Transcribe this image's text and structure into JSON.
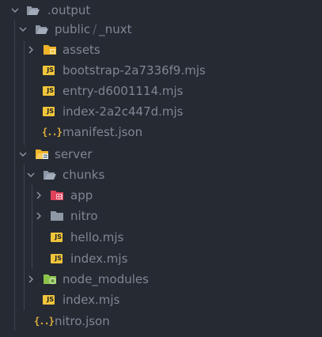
{
  "explorer": {
    "root": {
      "label": ".output",
      "icon": "folder-open-icon"
    },
    "public": {
      "label": "public",
      "separator": "/",
      "label_suffix": "_nuxt",
      "icon": "folder-open-icon"
    },
    "assets": {
      "label": "assets",
      "icon": "folder-assets-icon"
    },
    "bootstrap": {
      "label": "bootstrap-2a7336f9.mjs",
      "icon_text": "JS"
    },
    "entry": {
      "label": "entry-d6001114.mjs",
      "icon_text": "JS"
    },
    "index_nuxt": {
      "label": "index-2a2c447d.mjs",
      "icon_text": "JS"
    },
    "manifest": {
      "label": "manifest.json",
      "icon_text": "{..}"
    },
    "server": {
      "label": "server",
      "icon": "folder-server-icon"
    },
    "chunks": {
      "label": "chunks",
      "icon": "folder-open-icon"
    },
    "app": {
      "label": "app",
      "icon": "folder-app-icon"
    },
    "nitro_dir": {
      "label": "nitro",
      "icon": "folder-icon"
    },
    "hello": {
      "label": "hello.mjs",
      "icon_text": "JS"
    },
    "index_chunks": {
      "label": "index.mjs",
      "icon_text": "JS"
    },
    "node_modules": {
      "label": "node_modules",
      "icon": "folder-node-icon"
    },
    "index_server": {
      "label": "index.mjs",
      "icon_text": "JS"
    },
    "nitro_json": {
      "label": "nitro.json",
      "icon_text": "{..}"
    }
  },
  "colors": {
    "background": "#262a33",
    "text": "#7e8794",
    "folder": "#8d97a6",
    "js_badge": "#f0c53a",
    "json": "#e2b13c",
    "app_folder": "#e0425a",
    "node_folder": "#8bc34a",
    "guide": "#3e4450"
  }
}
